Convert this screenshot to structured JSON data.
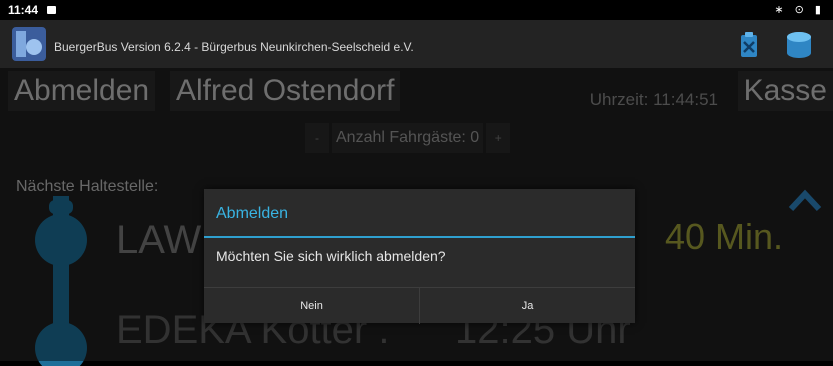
{
  "status_bar": {
    "time": "11:44",
    "right_icons": [
      "bluetooth-icon",
      "location-icon",
      "battery-icon"
    ],
    "right_text": "∗ ⊙ ▮"
  },
  "app_bar": {
    "title": "BuergerBus Version 6.2.4 - Bürgerbus Neunkirchen-Seelscheid e.V.",
    "icons": [
      "clipboard-icon",
      "database-icon"
    ]
  },
  "header": {
    "logout_label": "Abmelden",
    "driver_name": "Alfred Ostendorf",
    "clock": "Uhrzeit: 11:44:51",
    "kasse_label": "Kasse"
  },
  "passengers": {
    "minus": "-",
    "label": "Anzahl Fahrgäste: 0",
    "plus": "+"
  },
  "next_stop_label": "Nächste Haltestelle:",
  "stops": [
    {
      "name": "LAW",
      "info": "40 Min."
    },
    {
      "name": "EDEKA Kötter .",
      "info": "12:25 Uhr"
    }
  ],
  "dialog": {
    "title": "Abmelden",
    "message": "Möchten Sie sich wirklich abmelden?",
    "no_label": "Nein",
    "yes_label": "Ja"
  },
  "colors": {
    "accent": "#39b4e3",
    "route": "#1d6f99",
    "eta": "#9fa13a",
    "background": "#1f1f1f"
  }
}
